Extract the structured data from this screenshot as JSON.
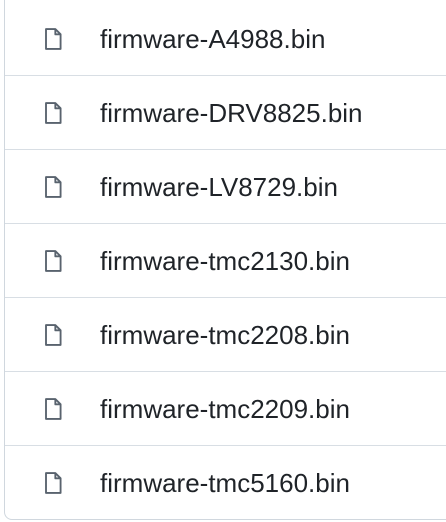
{
  "file_list": {
    "items": [
      {
        "name": "firmware-A4988.bin",
        "icon": "file-icon"
      },
      {
        "name": "firmware-DRV8825.bin",
        "icon": "file-icon"
      },
      {
        "name": "firmware-LV8729.bin",
        "icon": "file-icon"
      },
      {
        "name": "firmware-tmc2130.bin",
        "icon": "file-icon"
      },
      {
        "name": "firmware-tmc2208.bin",
        "icon": "file-icon"
      },
      {
        "name": "firmware-tmc2209.bin",
        "icon": "file-icon"
      },
      {
        "name": "firmware-tmc5160.bin",
        "icon": "file-icon"
      }
    ]
  },
  "colors": {
    "text": "#1f2328",
    "icon": "#59636e",
    "border": "#d0d7de"
  }
}
